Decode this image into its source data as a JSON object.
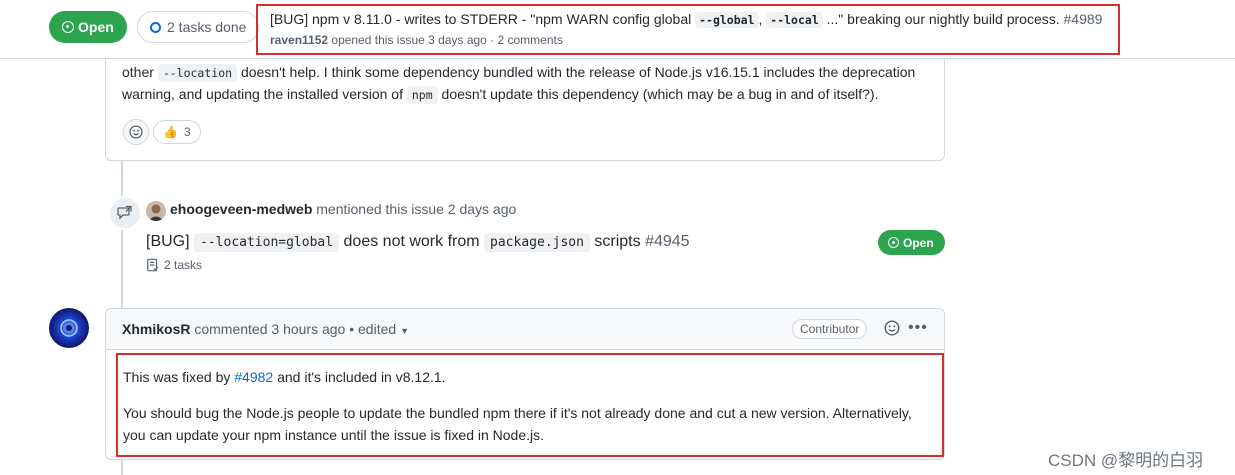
{
  "header": {
    "state_label": "Open",
    "tasks_label": "2 tasks done",
    "title_prefix": "[BUG] npm v 8.11.0 - writes to STDERR - \"npm WARN config global ",
    "title_code_1": "--global",
    "title_sep": ", ",
    "title_code_2": "--local",
    "title_suffix": " ...\" breaking our nightly build process. ",
    "issue_number": "#4989",
    "author": "raven1152",
    "meta_text": " opened this issue 3 days ago · 2 comments"
  },
  "previous_comment": {
    "text_1": "other ",
    "code_1": "--location",
    "text_2": " doesn't help. I think some dependency bundled with the release of Node.js v16.15.1 includes the deprecation warning, and updating the installed version of ",
    "code_2": "npm",
    "text_3": " doesn't update this dependency (which may be a bug in and of itself?).",
    "reaction_emoji": "👍",
    "reaction_count": "3"
  },
  "mention_event": {
    "author": "ehoogeveen-medweb",
    "action_text": " mentioned this issue 2 days ago",
    "ref_prefix": "[BUG] ",
    "ref_code_1": "--location=global",
    "ref_middle": " does not work from ",
    "ref_code_2": "package.json",
    "ref_suffix": " scripts ",
    "ref_number": "#4945",
    "ref_tasks": "2 tasks",
    "ref_state": "Open"
  },
  "comment": {
    "author": "XhmikosR",
    "meta_text": " commented 3 hours ago • edited ",
    "badge": "Contributor",
    "p1_before": "This was fixed by ",
    "p1_link": "#4982",
    "p1_after": " and it's included in v8.12.1.",
    "p2": "You should bug the Node.js people to update the bundled npm there if it's not already done and cut a new version. Alternatively, you can update your npm instance until the issue is fixed in Node.js."
  },
  "watermark": "CSDN @黎明的白羽",
  "colors": {
    "open_green": "#2da44e",
    "highlight_red": "#d32f2f",
    "link_blue": "#0969da"
  }
}
